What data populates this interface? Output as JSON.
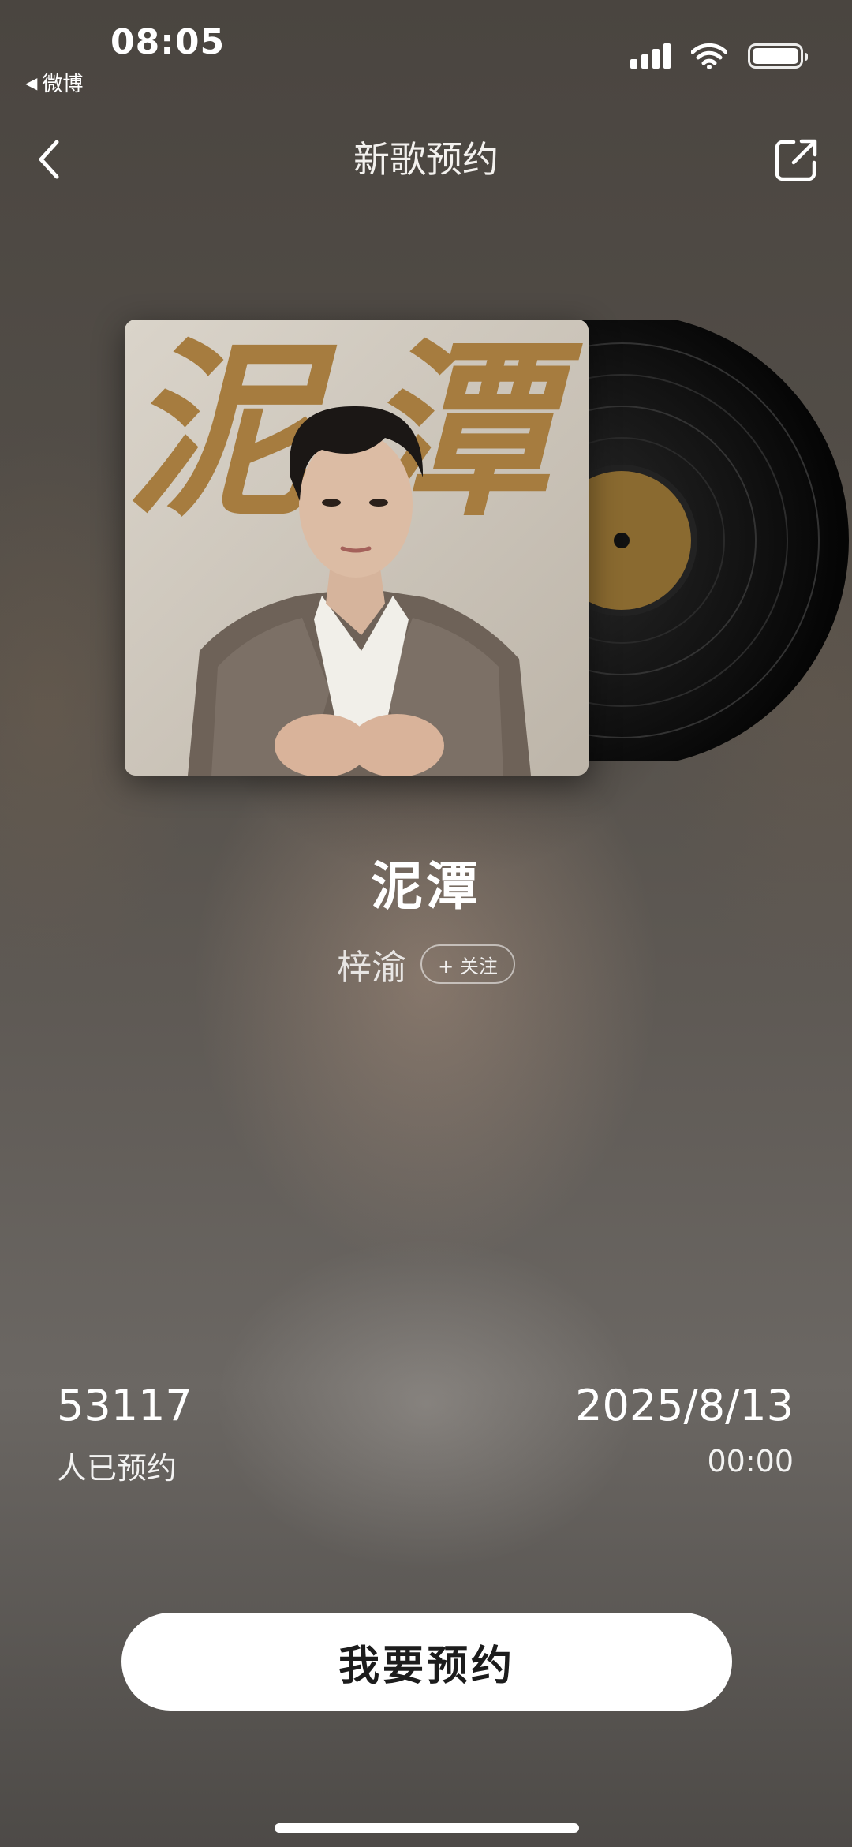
{
  "status_bar": {
    "time": "08:05",
    "back_app": "微博",
    "back_glyph": "◀",
    "icons": [
      "signal-icon",
      "wifi-icon",
      "battery-icon"
    ]
  },
  "nav": {
    "title": "新歌预约",
    "back_icon": "chevron-left-icon",
    "share_icon": "share-icon"
  },
  "album": {
    "cover_text": "泥潭",
    "cover_text_color": "#a67c3f"
  },
  "song": {
    "title": "泥潭",
    "artist": "梓渝",
    "follow_label": "+ 关注"
  },
  "stats": {
    "reserve_count": "53117",
    "reserve_label": "人已预约",
    "release_date": "2025/8/13",
    "release_time": "00:00"
  },
  "cta": {
    "label": "我要预约"
  },
  "colors": {
    "cta_bg": "#ffffff",
    "cta_text": "#1c1c1c",
    "text": "#ffffff"
  }
}
